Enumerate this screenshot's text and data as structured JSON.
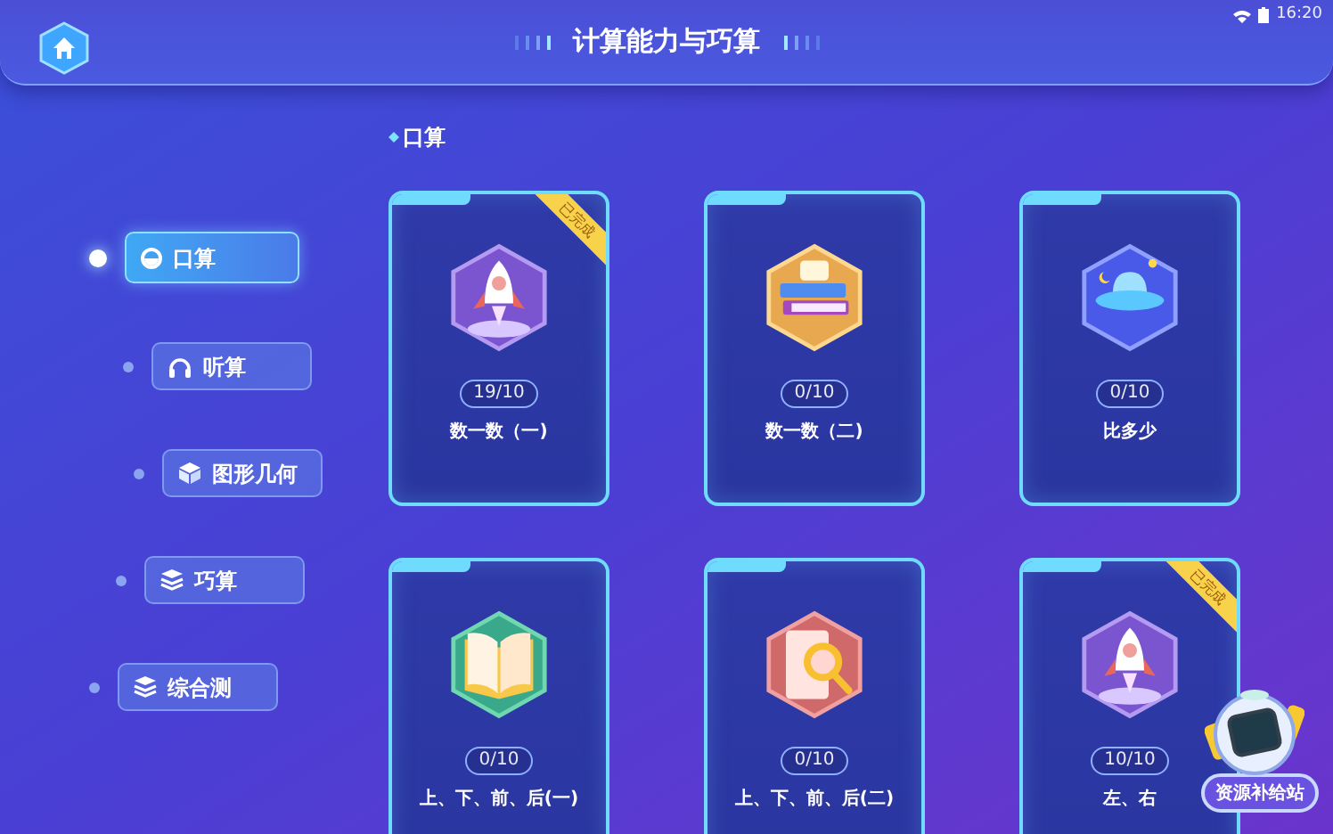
{
  "status_bar": {
    "time": "16:20"
  },
  "header": {
    "title": "计算能力与巧算"
  },
  "sidebar": {
    "items": [
      {
        "label": "口算",
        "kind": "circle",
        "selected": true
      },
      {
        "label": "听算",
        "kind": "headphones",
        "selected": false
      },
      {
        "label": "图形几何",
        "kind": "cube",
        "selected": false
      },
      {
        "label": "巧算",
        "kind": "layers",
        "selected": false
      },
      {
        "label": "综合测",
        "kind": "layers",
        "selected": false
      }
    ]
  },
  "section": {
    "title": "口算"
  },
  "cards": [
    {
      "title": "数一数（一)",
      "progress": "19/10",
      "kind": "rocket",
      "badge": "已完成"
    },
    {
      "title": "数一数（二)",
      "progress": "0/10",
      "kind": "books"
    },
    {
      "title": "比多少",
      "progress": "0/10",
      "kind": "ufo"
    },
    {
      "title": "上、下、前、后(一)",
      "progress": "0/10",
      "kind": "openbook"
    },
    {
      "title": "上、下、前、后(二)",
      "progress": "0/10",
      "kind": "magnifier"
    },
    {
      "title": "左、右",
      "progress": "10/10",
      "kind": "rocket",
      "badge": "已完成"
    }
  ],
  "resource_button": {
    "label": "资源补给站"
  }
}
